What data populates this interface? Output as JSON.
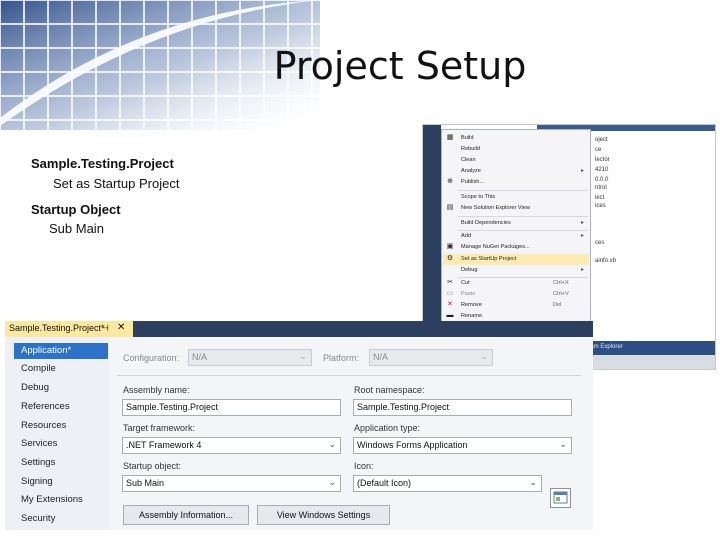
{
  "slide": {
    "title": "Project Setup",
    "bullets": [
      {
        "main": "Sample.Testing.Project",
        "sub": "Set as Startup Project"
      },
      {
        "main": "Startup Object",
        "sub": "Sub Main"
      }
    ]
  },
  "context_menu": {
    "items": [
      {
        "label": "Build",
        "icon": "build-icon"
      },
      {
        "label": "Rebuild"
      },
      {
        "label": "Clean"
      },
      {
        "label": "Analyze",
        "submenu": true
      },
      {
        "label": "Publish...",
        "icon": "publish-icon"
      },
      {
        "label": "Scope to This"
      },
      {
        "label": "New Solution Explorer View",
        "icon": "solution-explorer-icon"
      },
      {
        "label": "Build Dependencies",
        "submenu": true
      },
      {
        "label": "Add",
        "submenu": true
      },
      {
        "label": "Manage NuGet Packages...",
        "icon": "nuget-icon"
      },
      {
        "label": "Set as StartUp Project",
        "icon": "gear-icon",
        "highlighted": true
      },
      {
        "label": "Debug",
        "submenu": true
      },
      {
        "label": "Cut",
        "icon": "scissors-icon",
        "shortcut": "Ctrl+X"
      },
      {
        "label": "Paste",
        "icon": "paste-icon",
        "shortcut": "Ctrl+V"
      },
      {
        "label": "Remove",
        "icon": "remove-icon",
        "shortcut": "Del"
      },
      {
        "label": "Rename",
        "icon": "rename-icon"
      }
    ],
    "tree_fragments": [
      "oject",
      "ce",
      "lector",
      "4210",
      "0.0.0",
      "ntrol",
      "lect",
      "ices",
      "ces",
      "ainfo.vb"
    ],
    "bottom_tab": "eam Explorer"
  },
  "properties": {
    "tab_label": "Sample.Testing.Project*",
    "nav": [
      "Application*",
      "Compile",
      "Debug",
      "References",
      "Resources",
      "Services",
      "Settings",
      "Signing",
      "My Extensions",
      "Security"
    ],
    "configuration_label": "Configuration:",
    "configuration_value": "N/A",
    "platform_label": "Platform:",
    "platform_value": "N/A",
    "assembly_name_label": "Assembly name:",
    "assembly_name_value": "Sample.Testing.Project",
    "root_namespace_label": "Root namespace:",
    "root_namespace_value": "Sample.Testing.Project",
    "target_framework_label": "Target framework:",
    ".target_framework_value": "",
    "target_framework_value": ".NET Framework 4",
    "application_type_label": "Application type:",
    "application_type_value": "Windows Forms Application",
    "startup_object_label": "Startup object:",
    "startup_object_value": "Sub Main",
    "icon_label": "Icon:",
    "icon_value": "(Default Icon)",
    "assembly_info_button": "Assembly Information...",
    "view_windows_settings_button": "View Windows Settings"
  },
  "colors": {
    "accent_blue": "#2e72c8",
    "tab_yellow": "#fce9a1",
    "menu_highlight": "#fcecb4",
    "frame_dark": "#2d3f5e"
  }
}
